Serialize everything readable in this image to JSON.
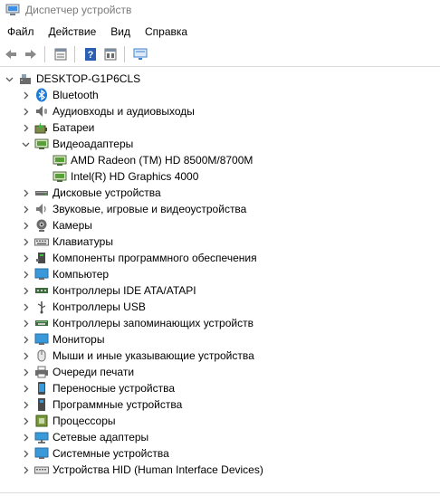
{
  "window": {
    "title": "Диспетчер устройств"
  },
  "menu": {
    "items": [
      "Файл",
      "Действие",
      "Вид",
      "Справка"
    ]
  },
  "toolbar": {
    "icons": [
      "back-arrow-icon",
      "forward-arrow-icon",
      "properties-icon",
      "help-icon",
      "view-icon",
      "monitor-scan-icon"
    ]
  },
  "tree": {
    "root": {
      "label": "DESKTOP-G1P6CLS",
      "expanded": true
    },
    "categories": [
      {
        "label": "Bluetooth",
        "icon": "bluetooth-icon",
        "expanded": false
      },
      {
        "label": "Аудиовходы и аудиовыходы",
        "icon": "speaker-mic-icon",
        "expanded": false
      },
      {
        "label": "Батареи",
        "icon": "battery-icon",
        "expanded": false
      },
      {
        "label": "Видеоадаптеры",
        "icon": "display-adapter-icon",
        "expanded": true,
        "children": [
          "AMD Radeon (TM) HD 8500M/8700M",
          "Intel(R) HD Graphics 4000"
        ]
      },
      {
        "label": "Дисковые устройства",
        "icon": "disk-drive-icon",
        "expanded": false
      },
      {
        "label": "Звуковые, игровые и видеоустройства",
        "icon": "sound-icon",
        "expanded": false
      },
      {
        "label": "Камеры",
        "icon": "camera-icon",
        "expanded": false
      },
      {
        "label": "Клавиатуры",
        "icon": "keyboard-icon",
        "expanded": false
      },
      {
        "label": "Компоненты программного обеспечения",
        "icon": "software-component-icon",
        "expanded": false
      },
      {
        "label": "Компьютер",
        "icon": "computer-icon",
        "expanded": false
      },
      {
        "label": "Контроллеры IDE ATA/ATAPI",
        "icon": "ide-controller-icon",
        "expanded": false
      },
      {
        "label": "Контроллеры USB",
        "icon": "usb-icon",
        "expanded": false
      },
      {
        "label": "Контроллеры запоминающих устройств",
        "icon": "storage-controller-icon",
        "expanded": false
      },
      {
        "label": "Мониторы",
        "icon": "monitor-icon",
        "expanded": false
      },
      {
        "label": "Мыши и иные указывающие устройства",
        "icon": "mouse-icon",
        "expanded": false
      },
      {
        "label": "Очереди печати",
        "icon": "printer-icon",
        "expanded": false
      },
      {
        "label": "Переносные устройства",
        "icon": "portable-device-icon",
        "expanded": false
      },
      {
        "label": "Программные устройства",
        "icon": "software-device-icon",
        "expanded": false
      },
      {
        "label": "Процессоры",
        "icon": "processor-icon",
        "expanded": false
      },
      {
        "label": "Сетевые адаптеры",
        "icon": "network-adapter-icon",
        "expanded": false
      },
      {
        "label": "Системные устройства",
        "icon": "system-device-icon",
        "expanded": false
      },
      {
        "label": "Устройства HID (Human Interface Devices)",
        "icon": "hid-icon",
        "expanded": false
      }
    ]
  },
  "colors": {
    "accent": "#1e7ad6",
    "chevron": "#5a5a5a",
    "title_text": "#7a7a7a"
  }
}
